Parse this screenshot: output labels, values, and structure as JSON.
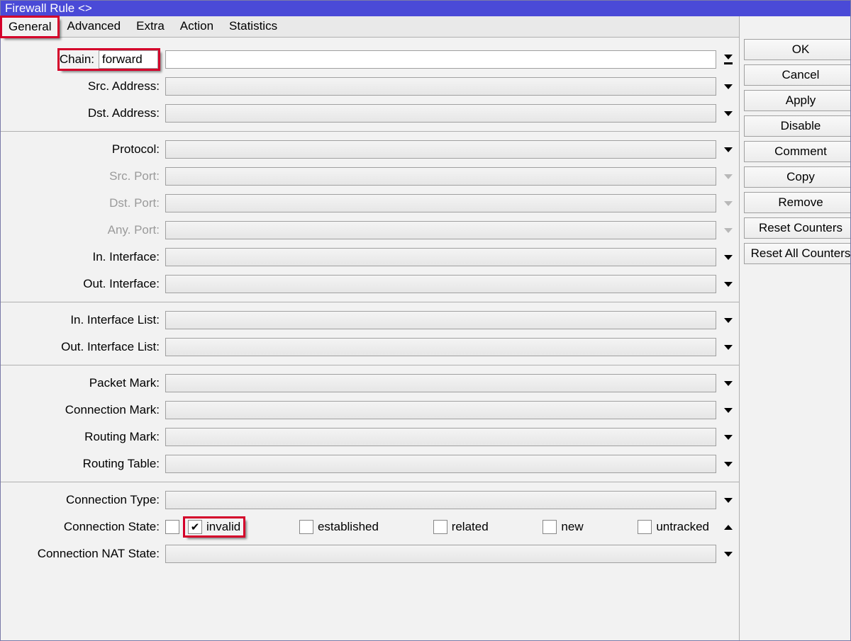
{
  "window": {
    "title": "Firewall Rule <>"
  },
  "tabs": {
    "general": "General",
    "advanced": "Advanced",
    "extra": "Extra",
    "action": "Action",
    "statistics": "Statistics"
  },
  "labels": {
    "chain": "Chain:",
    "src_address": "Src. Address:",
    "dst_address": "Dst. Address:",
    "protocol": "Protocol:",
    "src_port": "Src. Port:",
    "dst_port": "Dst. Port:",
    "any_port": "Any. Port:",
    "in_interface": "In. Interface:",
    "out_interface": "Out. Interface:",
    "in_interface_list": "In. Interface List:",
    "out_interface_list": "Out. Interface List:",
    "packet_mark": "Packet Mark:",
    "connection_mark": "Connection Mark:",
    "routing_mark": "Routing Mark:",
    "routing_table": "Routing Table:",
    "connection_type": "Connection Type:",
    "connection_state": "Connection State:",
    "connection_nat_state": "Connection NAT State:"
  },
  "values": {
    "chain": "forward"
  },
  "connection_state": {
    "invalid": {
      "label": "invalid",
      "checked": true
    },
    "established": {
      "label": "established",
      "checked": false
    },
    "related": {
      "label": "related",
      "checked": false
    },
    "new": {
      "label": "new",
      "checked": false
    },
    "untracked": {
      "label": "untracked",
      "checked": false
    }
  },
  "buttons": {
    "ok": "OK",
    "cancel": "Cancel",
    "apply": "Apply",
    "disable": "Disable",
    "comment": "Comment",
    "copy": "Copy",
    "remove": "Remove",
    "reset_counters": "Reset Counters",
    "reset_all_counters": "Reset All Counters"
  }
}
